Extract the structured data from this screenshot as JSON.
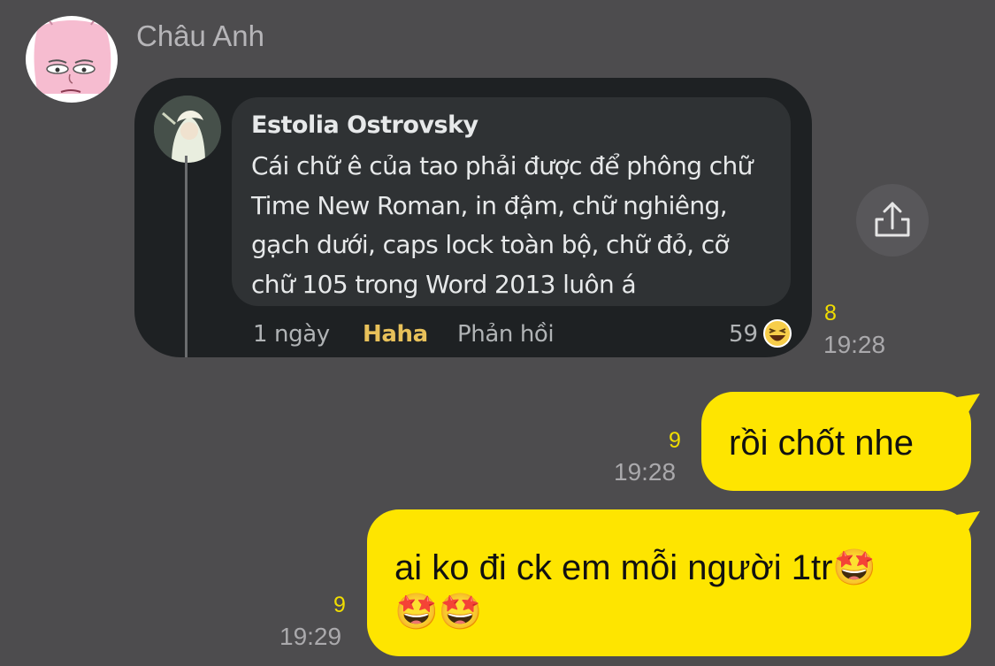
{
  "sender": {
    "name": "Châu Anh"
  },
  "shared_image": {
    "comment": {
      "author": "Estolia Ostrovsky",
      "lines": [
        "Cái chữ ê của tao phải được để phông chữ",
        "Time New Roman, in đậm, chữ nghiêng,",
        "gạch dưới, caps lock toàn bộ, chữ đỏ, cỡ",
        "chữ 105 trong Word 2013 luôn á"
      ],
      "age": "1 ngày",
      "reaction_label": "Haha",
      "reply_label": "Phản hồi",
      "reaction_count": "59"
    },
    "read_count": "8",
    "time": "19:28"
  },
  "messages": [
    {
      "text": "rồi chốt nhe",
      "read_count": "9",
      "time": "19:28"
    },
    {
      "lines": [
        "ai ko đi ck em mỗi người 1tr🤩",
        "🤩🤩"
      ],
      "read_count": "9",
      "time": "19:29"
    }
  ],
  "icons": {
    "share": "share-icon",
    "reaction": "laughing-emoji-icon",
    "avatar": "pink-face-avatar"
  },
  "colors": {
    "background": "#4d4c4e",
    "outgoing_bubble": "#fee500",
    "read_count": "#f0dd00",
    "timestamp": "#aaa9ac"
  }
}
